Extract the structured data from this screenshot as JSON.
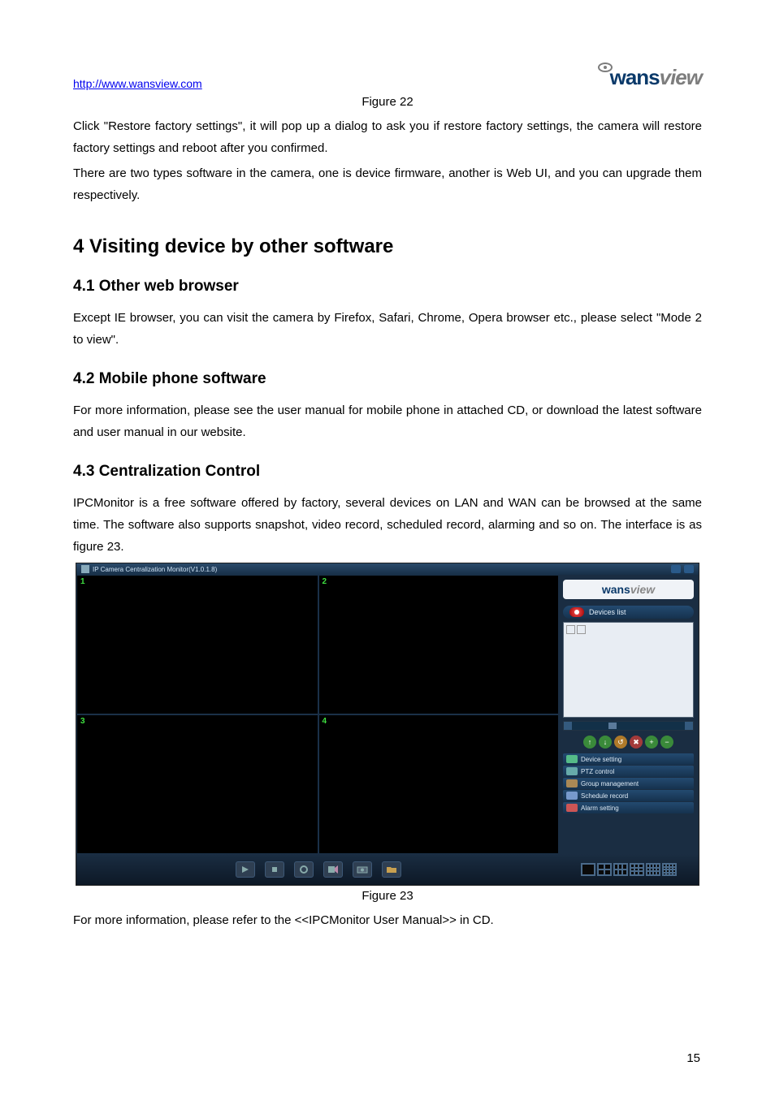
{
  "header": {
    "link": "http://www.wansview.com",
    "logo_a": "wans",
    "logo_b": "view"
  },
  "fig22": "Figure 22",
  "para1": "Click \"Restore factory settings\", it will pop up a dialog to ask you if restore factory settings, the camera will restore factory settings and reboot after you confirmed.",
  "para2": "There are two types software in the camera, one is device firmware, another is Web UI, and you can upgrade them respectively.",
  "section4": "4 Visiting device by other software",
  "sub41": "4.1 Other web browser",
  "para41": "Except IE browser, you can visit the camera by Firefox, Safari, Chrome, Opera browser etc., please select \"Mode 2 to view\".",
  "sub42": "4.2 Mobile phone software",
  "para42": "For more information, please see the user manual for mobile phone in attached CD, or download the latest software and user manual in our website.",
  "sub43": "4.3 Centralization Control",
  "para43": "IPCMonitor is a free software offered by factory, several devices on LAN and WAN can be browsed at the same time. The software also supports snapshot, video record, scheduled record, alarming and so on. The interface is as figure 23.",
  "app": {
    "title": "IP Camera Centralization Monitor(V1.0.1.8)",
    "cells": [
      "1",
      "2",
      "3",
      "4"
    ],
    "devlist": "Devices list",
    "accordion": [
      "Device setting",
      "PTZ control",
      "Group management",
      "Schedule record",
      "Alarm setting"
    ],
    "ptz_colors": [
      "#3a8a3a",
      "#3a8a3a",
      "#b07a2a",
      "#a33a3a",
      "#3a8a3a",
      "#3a8a3a"
    ],
    "ptz_glyphs": [
      "↑",
      "↓",
      "↺",
      "✖",
      "+",
      "−"
    ]
  },
  "fig23": "Figure 23",
  "para_after": "For more information, please refer to the <<IPCMonitor User Manual>> in CD.",
  "pagenum": "15"
}
